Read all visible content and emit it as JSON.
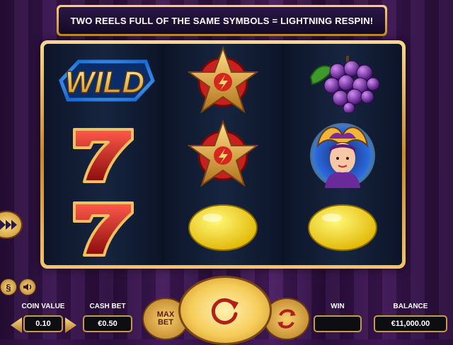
{
  "banner": {
    "text": "TWO REELS FULL OF THE SAME SYMBOLS = LIGHTNING RESPIN!"
  },
  "reels": [
    [
      "wild",
      "seven",
      "seven"
    ],
    [
      "star",
      "star",
      "lemon"
    ],
    [
      "grapes",
      "jester",
      "lemon"
    ]
  ],
  "wild_text": "WILD",
  "controls": {
    "coin_value_label": "COIN VALUE",
    "coin_value": "0.10",
    "cash_bet_label": "CASH BET",
    "cash_bet": "€0.50",
    "max_bet_line1": "MAX",
    "max_bet_line2": "BET",
    "win_label": "WIN",
    "win_value": "",
    "balance_label": "BALANCE",
    "balance": "€11,000.00",
    "dollar_icon": "§"
  },
  "icons": [
    "fast-forward-icon",
    "paytable-icon",
    "sound-icon",
    "minus-arrow-icon",
    "plus-arrow-icon",
    "spin-icon",
    "autoplay-icon"
  ],
  "colors": {
    "gold": "#c88a2a",
    "reel_bg": "#0e1830",
    "background": "#3b1551"
  }
}
